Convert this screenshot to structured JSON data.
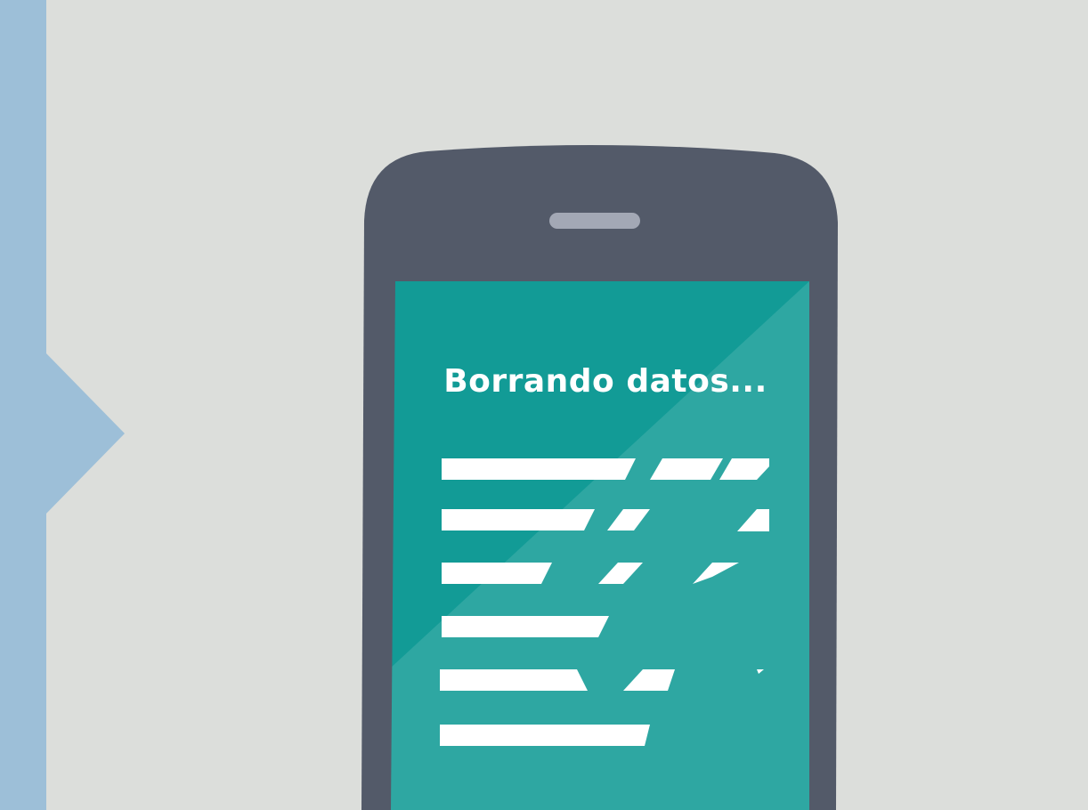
{
  "screen": {
    "title": "Borrando datos..."
  },
  "icons": {
    "side_arrow": "chevron-right-icon",
    "phone": "smartphone-icon",
    "speaker": "earpiece-speaker-icon",
    "data_lines": "shredding-text-lines-icon"
  },
  "colors": {
    "background": "#dcdedb",
    "side_accent": "#9dbfd8",
    "phone_body": "#535a69",
    "speaker": "#a3a8b5",
    "screen": "#129b96",
    "lines": "#ffffff"
  }
}
